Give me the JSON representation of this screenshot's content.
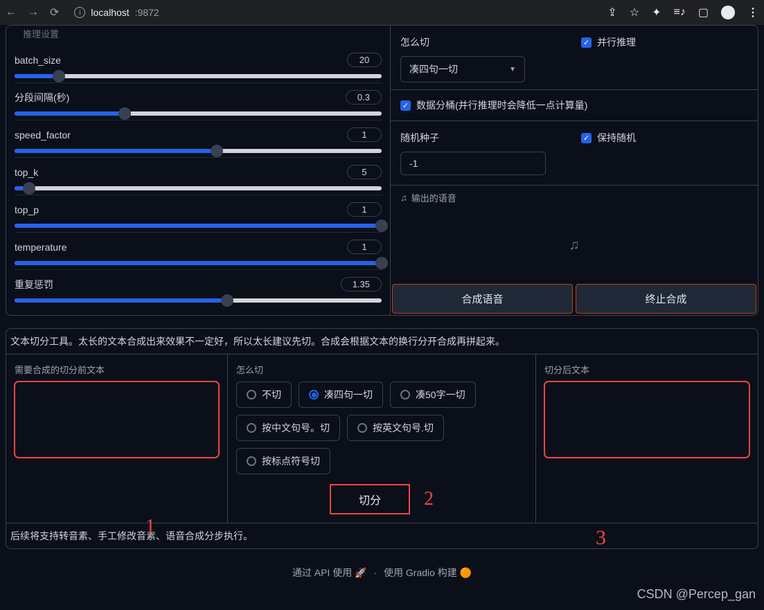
{
  "browser": {
    "url_host": "localhost",
    "url_port": ":9872"
  },
  "section_top_title": "推理设置",
  "sliders": {
    "batch_size": {
      "label": "batch_size",
      "value": "20",
      "fill": 12
    },
    "seg_interval": {
      "label": "分段间隔(秒)",
      "value": "0.3",
      "fill": 30
    },
    "speed_factor": {
      "label": "speed_factor",
      "value": "1",
      "fill": 55
    },
    "top_k": {
      "label": "top_k",
      "value": "5",
      "fill": 4
    },
    "top_p": {
      "label": "top_p",
      "value": "1",
      "fill": 100
    },
    "temperature": {
      "label": "temperature",
      "value": "1",
      "fill": 100
    },
    "repeat_penalty": {
      "label": "重复惩罚",
      "value": "1.35",
      "fill": 58
    }
  },
  "right": {
    "how_cut_label": "怎么切",
    "how_cut_value": "凑四句一切",
    "parallel_label": "并行推理",
    "bucket_label": "数据分桶(并行推理时会降低一点计算量)",
    "seed_label": "随机种子",
    "seed_value": "-1",
    "keep_random_label": "保持随机",
    "audio_out_label": "输出的语音",
    "btn_synth": "合成语音",
    "btn_stop": "终止合成"
  },
  "tool": {
    "desc": "文本切分工具。太长的文本合成出来效果不一定好，所以太长建议先切。合成会根据文本的换行分开合成再拼起来。",
    "pre_label": "需要合成的切分前文本",
    "how_label": "怎么切",
    "radios": {
      "r1": "不切",
      "r2": "凑四句一切",
      "r3": "凑50字一切",
      "r4": "按中文句号。切",
      "r5": "按英文句号.切",
      "r6": "按标点符号切"
    },
    "cut_btn": "切分",
    "post_label": "切分后文本",
    "footer": "后续将支持转音素、手工修改音素、语音合成分步执行。"
  },
  "credits": {
    "api": "通过 API 使用",
    "rocket": "🚀",
    "gradio": "使用 Gradio 构建",
    "g_icon": "🟠"
  },
  "watermark": "CSDN @Percep_gan",
  "hand": {
    "n1": "1",
    "n2": "2",
    "n3": "3"
  }
}
